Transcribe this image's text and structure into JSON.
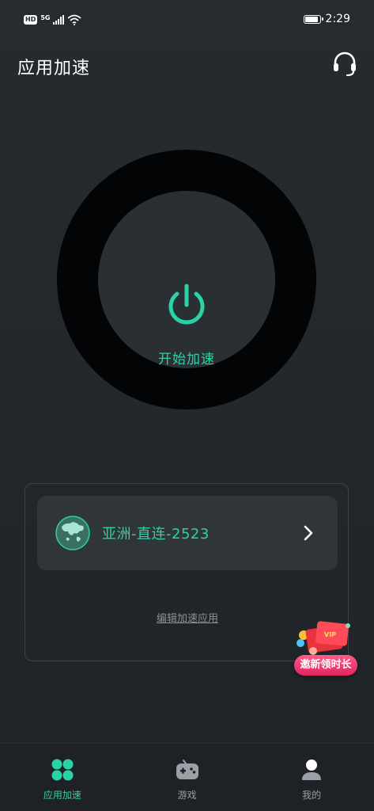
{
  "status_bar": {
    "hd": "HD",
    "network": "5G",
    "time": "2:29"
  },
  "header": {
    "title": "应用加速"
  },
  "accelerator": {
    "start_label": "开始加速"
  },
  "region": {
    "name": "亚洲-直连-2523"
  },
  "edit_apps_label": "编辑加速应用",
  "promo": {
    "label": "邀新领时长"
  },
  "tabs": [
    {
      "label": "应用加速",
      "icon": "four-dots-icon",
      "active": true
    },
    {
      "label": "游戏",
      "icon": "gamepad-icon",
      "active": false
    },
    {
      "label": "我的",
      "icon": "profile-icon",
      "active": false
    }
  ],
  "colors": {
    "accent": "#2ad3a4",
    "background": "#24292d",
    "ring": "#030405",
    "promo": "#e2245f"
  }
}
